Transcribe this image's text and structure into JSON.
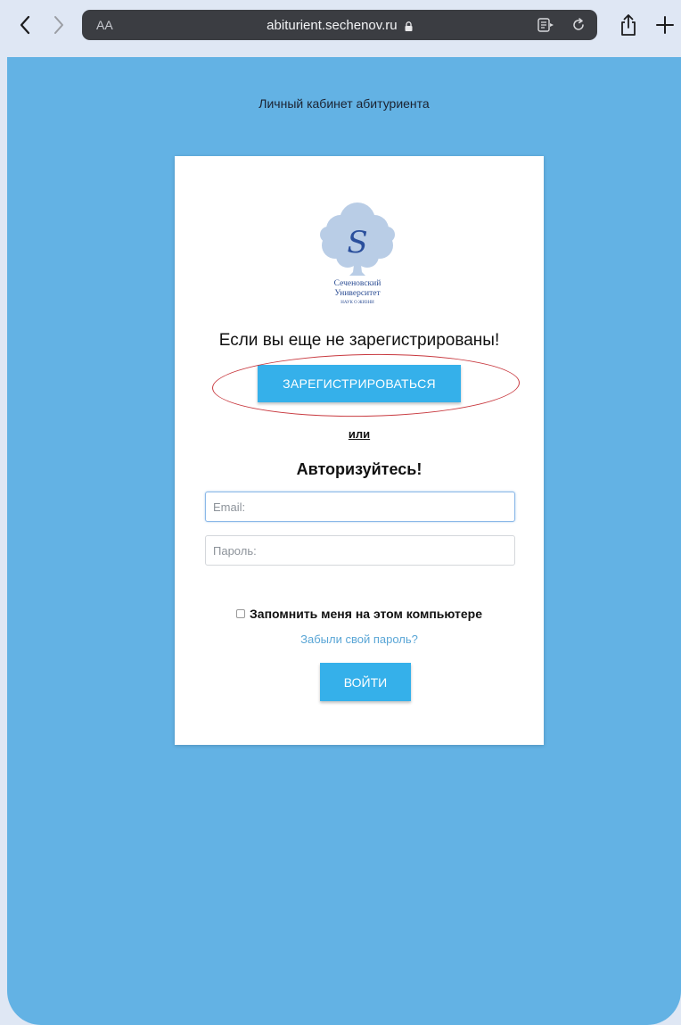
{
  "browser": {
    "aa_label": "AA",
    "url": "abiturient.sechenov.ru"
  },
  "page": {
    "title": "Личный кабинет абитуриента"
  },
  "logo": {
    "line1": "Сеченовский",
    "line2": "Университет",
    "line3": "НАУК О ЖИЗНИ",
    "letter": "S"
  },
  "register": {
    "heading": "Если вы еще не зарегистрированы!",
    "button_label": "ЗАРЕГИСТРИРОВАТЬСЯ"
  },
  "auth": {
    "or_label": "или",
    "heading": "Авторизуйтесь!",
    "email_placeholder": "Email:",
    "password_placeholder": "Пароль:",
    "remember_label": "Запомнить меня на этом компьютере",
    "forgot_label": "Забыли свой пароль?",
    "login_label": "ВОЙТИ"
  },
  "colors": {
    "background": "#63b2e4",
    "button": "#35b0ea",
    "highlight_ellipse": "#c8393f"
  }
}
